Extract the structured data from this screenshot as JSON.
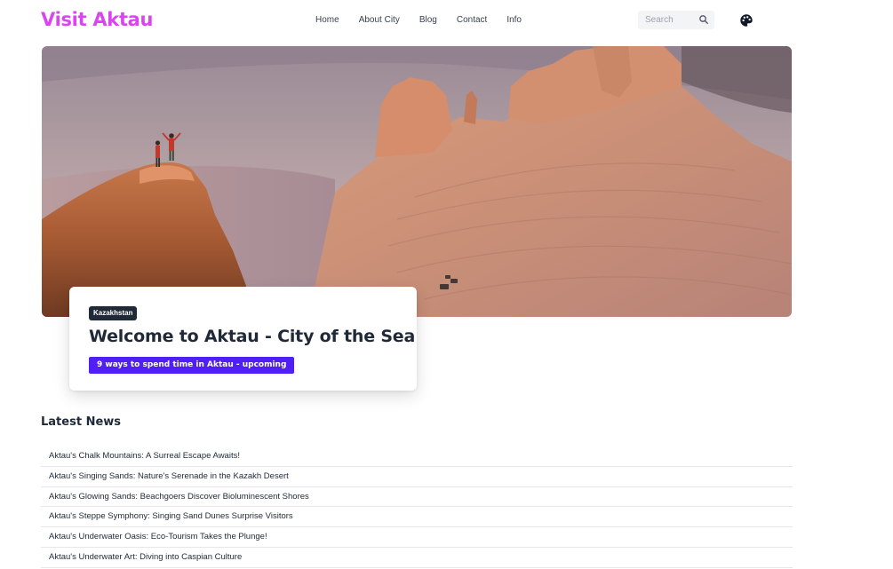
{
  "header": {
    "brand": "Visit Aktau",
    "nav": [
      "Home",
      "About City",
      "Blog",
      "Contact",
      "Info"
    ],
    "search_placeholder": "Search",
    "icons": {
      "search": "search-icon",
      "theme": "palette-icon"
    }
  },
  "hero": {
    "image": "desert-chalk-mountains-photo",
    "tag": "Kazakhstan",
    "title": "Welcome to Aktau - City of the Sea",
    "cta": "9 ways to spend time in Aktau - upcoming"
  },
  "news": {
    "heading": "Latest News",
    "items": [
      "Aktau's Chalk Mountains: A Surreal Escape Awaits!",
      "Aktau's Singing Sands: Nature's Serenade in the Kazakh Desert",
      "Aktau's Glowing Sands: Beachgoers Discover Bioluminescent Shores",
      "Aktau's Steppe Symphony: Singing Sand Dunes Surprise Visitors",
      "Aktau's Underwater Oasis: Eco-Tourism Takes the Plunge!",
      "Aktau's Underwater Art: Diving into Caspian Culture"
    ]
  },
  "colors": {
    "brand": "#d946ef",
    "cta": "#4f1ff5",
    "tag_bg": "#1f2937",
    "text": "#1f2937"
  }
}
